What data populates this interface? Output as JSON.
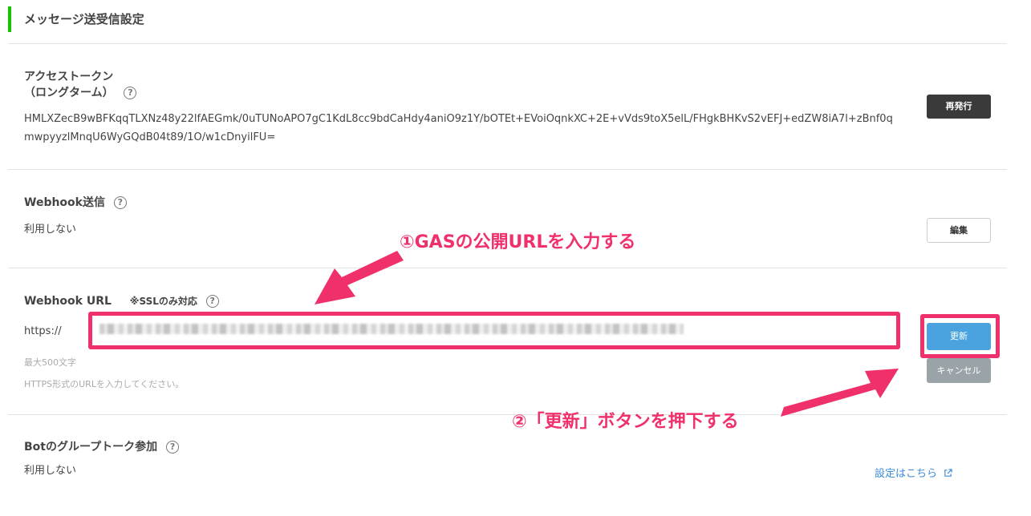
{
  "section": {
    "title": "メッセージ送受信設定"
  },
  "access_token": {
    "label_line1": "アクセストークン",
    "label_line2": "（ロングターム）",
    "help": "?",
    "value": "HMLXZecB9wBFKqqTLXNz48y22lfAEGmk/0uTUNoAPO7gC1KdL8cc9bdCaHdy4aniO9z1Y/bOTEt+EVoiOqnkXC+2E+vVds9toX5elL/FHgkBHKvS2vEFJ+edZW8iA7l+zBnf0qmwpyyzlMnqU6WyGQdB04t89/1O/w1cDnyilFU=",
    "reissue_label": "再発行"
  },
  "webhook_send": {
    "label": "Webhook送信",
    "help": "?",
    "value": "利用しない",
    "edit_label": "編集"
  },
  "webhook_url": {
    "label": "Webhook URL",
    "note": "※SSLのみ対応",
    "help": "?",
    "prefix": "https://",
    "input_value": "",
    "max_hint": "最大500文字",
    "format_hint": "HTTPS形式のURLを入力してください。",
    "update_label": "更新",
    "cancel_label": "キャンセル"
  },
  "bot_group": {
    "label": "Botのグループトーク参加",
    "help": "?",
    "value": "利用しない",
    "link_label": "設定はこちら",
    "link_icon": "external-link-icon"
  },
  "annotations": {
    "step1": "①GASの公開URLを入力する",
    "step2": "②「更新」ボタンを押下する",
    "accent_color": "#f0306a"
  },
  "colors": {
    "section_accent": "#17c400",
    "primary_button": "#4aa3de",
    "dark_button": "#3a3a3a",
    "disabled_button": "#9aa3a8",
    "link": "#3b8dd9"
  }
}
